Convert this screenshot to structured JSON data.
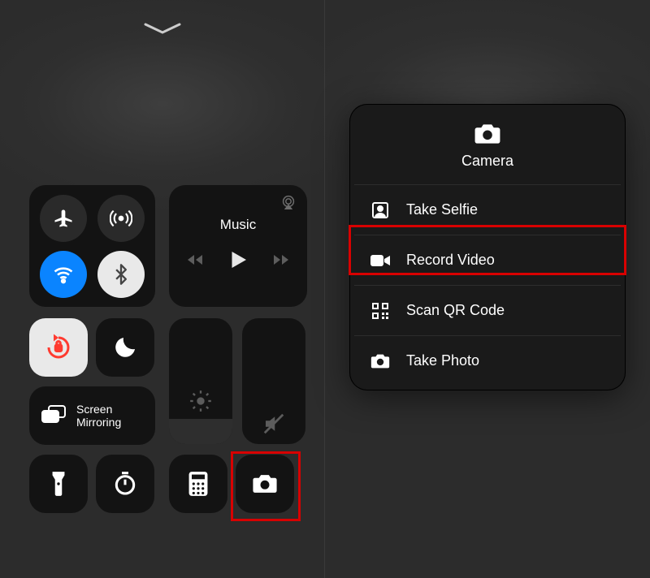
{
  "leftPane": {
    "media": {
      "title": "Music"
    },
    "screenMirroring": {
      "label": "Screen\nMirroring"
    },
    "icons": {
      "airplane": "airplane-icon",
      "cellular": "cellular-icon",
      "wifi": "wifi-icon",
      "bluetooth": "bluetooth-icon",
      "orientationLock": "orientation-lock-icon",
      "dnd": "moon-icon",
      "brightness": "brightness-icon",
      "volumeMute": "volume-mute-icon",
      "flashlight": "flashlight-icon",
      "timer": "timer-icon",
      "calculator": "calculator-icon",
      "camera": "camera-icon"
    }
  },
  "cameraMenu": {
    "title": "Camera",
    "items": [
      {
        "icon": "selfie-icon",
        "label": "Take Selfie"
      },
      {
        "icon": "video-icon",
        "label": "Record Video"
      },
      {
        "icon": "qr-icon",
        "label": "Scan QR Code"
      },
      {
        "icon": "camera-icon",
        "label": "Take Photo"
      }
    ]
  },
  "highlights": {
    "cameraTile": true,
    "recordVideo": true
  },
  "colors": {
    "highlight": "#d80000",
    "wifiActive": "#0a84ff"
  }
}
